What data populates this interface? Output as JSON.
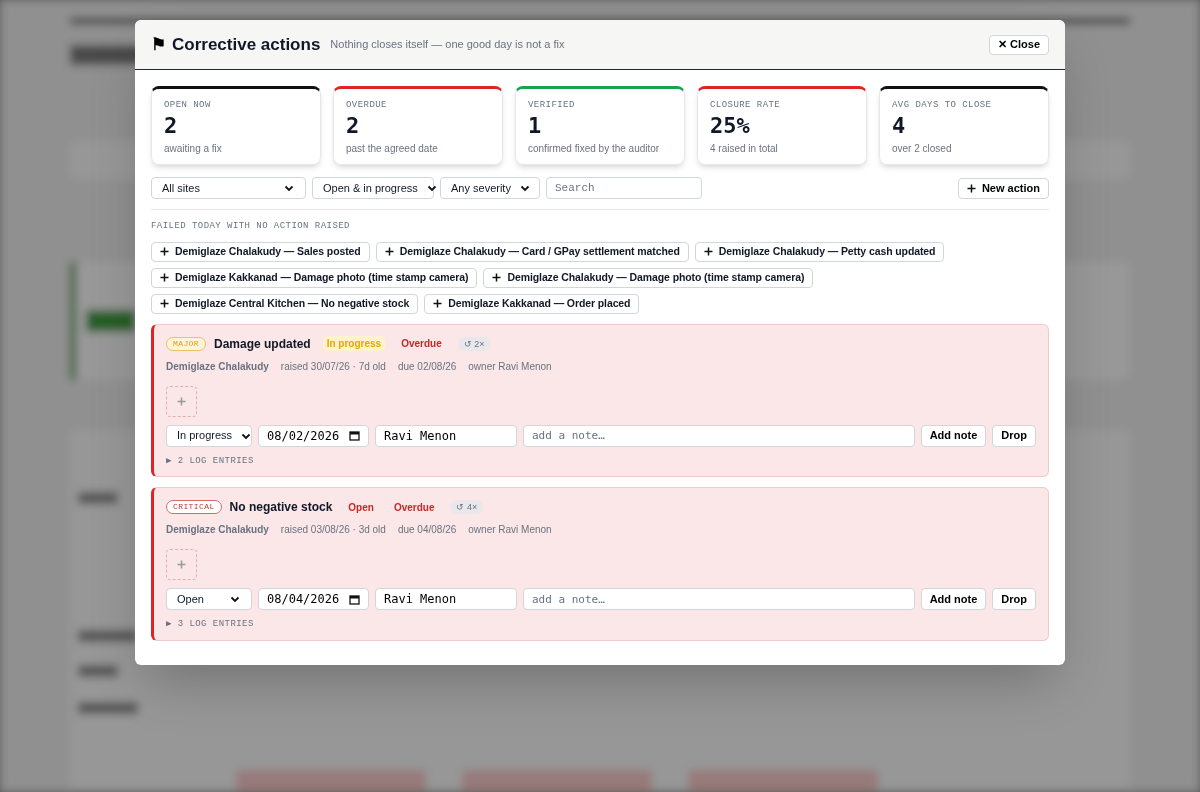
{
  "dialog": {
    "icon": "⚑",
    "title": "Corrective actions",
    "subtitle": "Nothing closes itself — one good day is not a fix",
    "close": {
      "icon": "✕",
      "label": "Close"
    }
  },
  "stats": [
    {
      "label": "OPEN NOW",
      "value": "2",
      "note": "awaiting a fix",
      "color": "#111111"
    },
    {
      "label": "OVERDUE",
      "value": "2",
      "note": "past the agreed date",
      "color": "#dc2626"
    },
    {
      "label": "VERIFIED",
      "value": "1",
      "note": "confirmed fixed by the auditor",
      "color": "#16a34a"
    },
    {
      "label": "CLOSURE RATE",
      "value": "25%",
      "note": "4 raised in total",
      "color": "#dc2626"
    },
    {
      "label": "AVG DAYS TO CLOSE",
      "value": "4",
      "note": "over 2 closed",
      "color": "#111111"
    }
  ],
  "filters": {
    "site": "All sites",
    "status": "Open & in progress",
    "severity": "Any severity",
    "search_placeholder": "Search",
    "new_button": "New action"
  },
  "failed_section": {
    "heading": "FAILED TODAY WITH NO ACTION RAISED",
    "chips": [
      "Demiglaze Chalakudy — Sales posted",
      "Demiglaze Chalakudy — Card / GPay settlement matched",
      "Demiglaze Chalakudy — Petty cash updated",
      "Demiglaze Kakkanad — Damage photo (time stamp camera)",
      "Demiglaze Chalakudy — Damage photo (time stamp camera)",
      "Demiglaze Central Kitchen — No negative stock",
      "Demiglaze Kakkanad — Order placed"
    ]
  },
  "actions": [
    {
      "severity": {
        "kind": "major",
        "label": "MAJOR"
      },
      "title": "Damage updated",
      "status": {
        "kind": "in_progress",
        "label": "In progress"
      },
      "overdue": true,
      "overdue_label": "Overdue",
      "repeat": "↺ 2×",
      "site": "Demiglaze Chalakudy",
      "raised": "raised 30/07/26 · 7d old",
      "due": "due 02/08/26",
      "owner_text": "owner Ravi Menon",
      "status_select": "In progress",
      "date": "08/02/2026",
      "owner": "Ravi Menon",
      "note_placeholder": "add a note…",
      "add_note": "Add note",
      "drop": "Drop",
      "log_toggle": "▶",
      "log": "2 LOG ENTRIES"
    },
    {
      "severity": {
        "kind": "critical",
        "label": "CRITICAL"
      },
      "title": "No negative stock",
      "status": {
        "kind": "open",
        "label": "Open"
      },
      "overdue": true,
      "overdue_label": "Overdue",
      "repeat": "↺ 4×",
      "site": "Demiglaze Chalakudy",
      "raised": "raised 03/08/26 · 3d old",
      "due": "due 04/08/26",
      "owner_text": "owner Ravi Menon",
      "status_select": "Open",
      "date": "08/04/2026",
      "owner": "Ravi Menon",
      "note_placeholder": "add a note…",
      "add_note": "Add note",
      "drop": "Drop",
      "log_toggle": "▶",
      "log": "3 LOG ENTRIES"
    }
  ]
}
